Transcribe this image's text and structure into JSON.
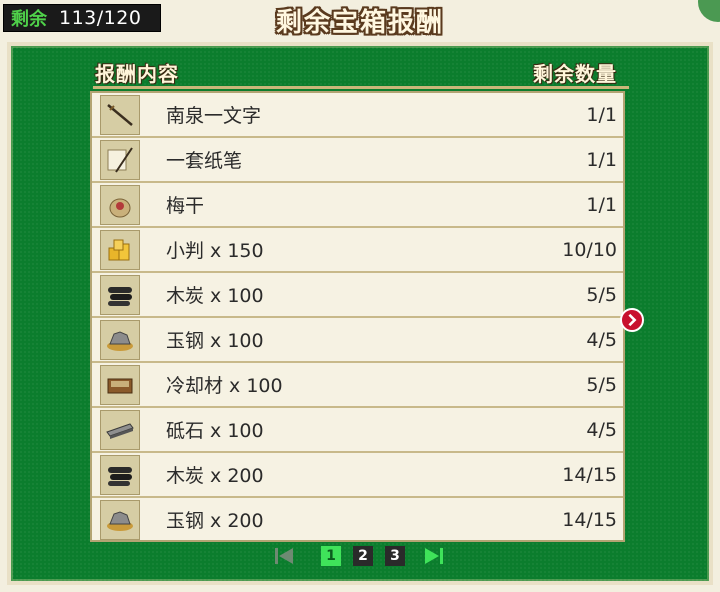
{
  "status": {
    "remaining_label": "剩余",
    "remaining_value": "113/120"
  },
  "title": "剩余宝箱报酬",
  "table": {
    "header_content": "报酬内容",
    "header_quantity": "剩余数量",
    "rows": [
      {
        "name": "南泉一文字",
        "qty": "1/1",
        "icon": "sword-icon"
      },
      {
        "name": "一套纸笔",
        "qty": "1/1",
        "icon": "paper-brush-icon"
      },
      {
        "name": "梅干",
        "qty": "1/1",
        "icon": "pickled-plum-icon"
      },
      {
        "name": "小判 x 150",
        "qty": "10/10",
        "icon": "gold-coins-icon"
      },
      {
        "name": "木炭 x 100",
        "qty": "5/5",
        "icon": "charcoal-icon"
      },
      {
        "name": "玉钢 x 100",
        "qty": "4/5",
        "icon": "steel-ore-icon"
      },
      {
        "name": "冷却材 x 100",
        "qty": "5/5",
        "icon": "coolant-box-icon"
      },
      {
        "name": "砥石 x 100",
        "qty": "4/5",
        "icon": "whetstone-icon"
      },
      {
        "name": "木炭 x 200",
        "qty": "14/15",
        "icon": "charcoal-icon"
      },
      {
        "name": "玉钢 x 200",
        "qty": "14/15",
        "icon": "steel-ore-icon"
      }
    ]
  },
  "pagination": {
    "pages": [
      "1",
      "2",
      "3"
    ],
    "current": "1"
  },
  "colors": {
    "panel_green": "#0b7d2d",
    "active_page": "#3fe35a",
    "next_arrow": "#c8102e"
  }
}
